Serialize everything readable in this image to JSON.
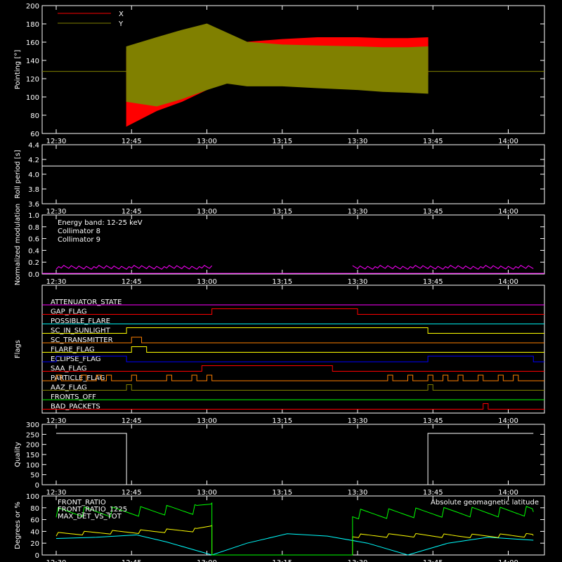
{
  "time_ticks": [
    "12:30",
    "12:45",
    "13:00",
    "13:15",
    "13:30",
    "13:45",
    "14:00"
  ],
  "chart_data": [
    {
      "type": "line",
      "ylabel": "Pointing [°]",
      "ylim": [
        60,
        200
      ],
      "yticks": [
        "60",
        "80",
        "100",
        "120",
        "140",
        "160",
        "180",
        "200"
      ],
      "legend": [
        {
          "name": "X",
          "color": "#ff0000"
        },
        {
          "name": "Y",
          "color": "#808000"
        }
      ],
      "x_minutes": [
        14,
        20,
        25,
        30,
        34,
        38,
        45,
        52,
        60,
        65,
        70,
        74
      ],
      "series": [
        {
          "name": "X",
          "color": "#ff0000",
          "upper": [
            150,
            155,
            150,
            150,
            155,
            160,
            163,
            165,
            165,
            164,
            164,
            165
          ],
          "lower": [
            68,
            85,
            95,
            108,
            118,
            120,
            124,
            125,
            125,
            124,
            123,
            124
          ]
        },
        {
          "name": "Y",
          "color": "#808000",
          "upper": [
            155,
            165,
            173,
            180,
            170,
            160,
            157,
            156,
            155,
            154,
            154,
            155
          ],
          "lower": [
            95,
            90,
            98,
            108,
            115,
            112,
            112,
            110,
            108,
            106,
            105,
            104
          ]
        }
      ],
      "baseline": 128,
      "data_start_minute": 14,
      "data_end_minute": 74
    },
    {
      "type": "line",
      "ylabel": "Roll period [s]",
      "ylim": [
        3.5,
        4.5
      ],
      "yticks": [
        "3.6",
        "3.8",
        "4.0",
        "4.2",
        "4.4"
      ],
      "series": [
        {
          "name": "",
          "color": "#ffffff",
          "y": 4.14
        }
      ]
    },
    {
      "type": "line",
      "ylabel": "Normalized modulation",
      "ylim": [
        0,
        1.0
      ],
      "yticks": [
        "0.0",
        "0.2",
        "0.4",
        "0.6",
        "0.8",
        "1.0"
      ],
      "annotations": [
        {
          "text": "Energy band: 12-25 keV",
          "color": "#ffffff"
        },
        {
          "text": "Collimator 8",
          "color": "#00ffff"
        },
        {
          "text": "Collimator 9",
          "color": "#ff00ff"
        }
      ],
      "segments": [
        {
          "start": 0,
          "end": 31,
          "level": 0.11,
          "color": "#ff00ff"
        },
        {
          "start": 59,
          "end": 95,
          "level": 0.11,
          "color": "#ff00ff"
        }
      ]
    },
    {
      "type": "line",
      "ylabel": "Flags",
      "flags": [
        {
          "name": "ATTENUATOR_STATE",
          "color": "#ff00ff",
          "high": []
        },
        {
          "name": "GAP_FLAG",
          "color": "#ff0000",
          "high": [
            [
              31,
              60
            ]
          ]
        },
        {
          "name": "POSSIBLE_FLARE",
          "color": "#00ffff",
          "high": []
        },
        {
          "name": "SC_IN_SUNLIGHT",
          "color": "#ffff00",
          "high": [
            [
              14,
              74
            ]
          ]
        },
        {
          "name": "SC_TRANSMITTER",
          "color": "#ff8000",
          "high": [
            [
              15,
              17
            ]
          ]
        },
        {
          "name": "FLARE_FLAG",
          "color": "#ffff00",
          "high": [
            [
              15,
              18
            ]
          ]
        },
        {
          "name": "ECLIPSE_FLAG",
          "color": "#0000ff",
          "high": [
            [
              0,
              14
            ],
            [
              74,
              95
            ]
          ]
        },
        {
          "name": "SAA_FLAG",
          "color": "#ff0000",
          "high": [
            [
              29,
              55
            ]
          ]
        },
        {
          "name": "PARTICLE_FLAG",
          "color": "#ff8000",
          "high": [
            [
              0,
              1
            ],
            [
              5,
              6
            ],
            [
              8,
              9
            ],
            [
              10,
              11
            ],
            [
              15,
              16
            ],
            [
              22,
              23
            ],
            [
              27,
              28
            ],
            [
              30,
              31
            ],
            [
              66,
              67
            ],
            [
              70,
              71
            ],
            [
              74,
              75
            ],
            [
              77,
              78
            ],
            [
              80,
              81
            ],
            [
              84,
              85
            ],
            [
              88,
              89
            ],
            [
              91,
              92
            ]
          ]
        },
        {
          "name": "AAZ_FLAG",
          "color": "#808000",
          "high": [
            [
              14,
              15
            ],
            [
              74,
              75
            ]
          ]
        },
        {
          "name": "FRONTS_OFF",
          "color": "#00ff00",
          "high": []
        },
        {
          "name": "BAD_PACKETS",
          "color": "#ff0000",
          "high": [
            [
              85,
              86
            ]
          ]
        }
      ]
    },
    {
      "type": "line",
      "ylabel": "Quality",
      "ylim": [
        0,
        300
      ],
      "yticks": [
        "0",
        "50",
        "100",
        "150",
        "200",
        "250",
        "300"
      ],
      "series": [
        {
          "name": "",
          "color": "#ffffff",
          "steps": [
            [
              0,
              255
            ],
            [
              14,
              255
            ],
            [
              14,
              0
            ],
            [
              74,
              0
            ],
            [
              74,
              255
            ],
            [
              95,
              255
            ]
          ]
        }
      ]
    },
    {
      "type": "line",
      "ylabel": "Degrees or %",
      "ylim": [
        0,
        100
      ],
      "yticks": [
        "0",
        "20",
        "40",
        "60",
        "80",
        "100"
      ],
      "legend": [
        {
          "name": "FRONT_RATIO",
          "color": "#ffffff"
        },
        {
          "name": "FRONT_RATIO_1225",
          "color": "#00ff00"
        },
        {
          "name": "MAX_DET_VS_TOT",
          "color": "#ffff00"
        }
      ],
      "label_right": {
        "text": "Absolute geomagnetic latitude",
        "color": "#00ffff"
      },
      "green": [
        [
          0,
          72
        ],
        [
          10,
          72
        ],
        [
          20,
          74
        ],
        [
          28,
          76
        ],
        [
          31,
          88
        ],
        [
          31,
          0
        ],
        [
          59,
          0
        ],
        [
          59,
          68
        ],
        [
          70,
          70
        ],
        [
          80,
          72
        ],
        [
          95,
          73
        ]
      ],
      "yellow": [
        [
          0,
          35
        ],
        [
          10,
          38
        ],
        [
          20,
          40
        ],
        [
          28,
          42
        ],
        [
          31,
          50
        ],
        [
          31,
          0
        ],
        [
          59,
          0
        ],
        [
          59,
          32
        ],
        [
          70,
          33
        ],
        [
          80,
          32
        ],
        [
          95,
          33
        ]
      ],
      "cyan": [
        [
          0,
          28
        ],
        [
          8,
          30
        ],
        [
          16,
          34
        ],
        [
          22,
          22
        ],
        [
          31,
          0
        ],
        [
          38,
          20
        ],
        [
          46,
          36
        ],
        [
          54,
          32
        ],
        [
          62,
          20
        ],
        [
          70,
          0
        ],
        [
          78,
          20
        ],
        [
          86,
          30
        ],
        [
          95,
          25
        ]
      ]
    }
  ]
}
